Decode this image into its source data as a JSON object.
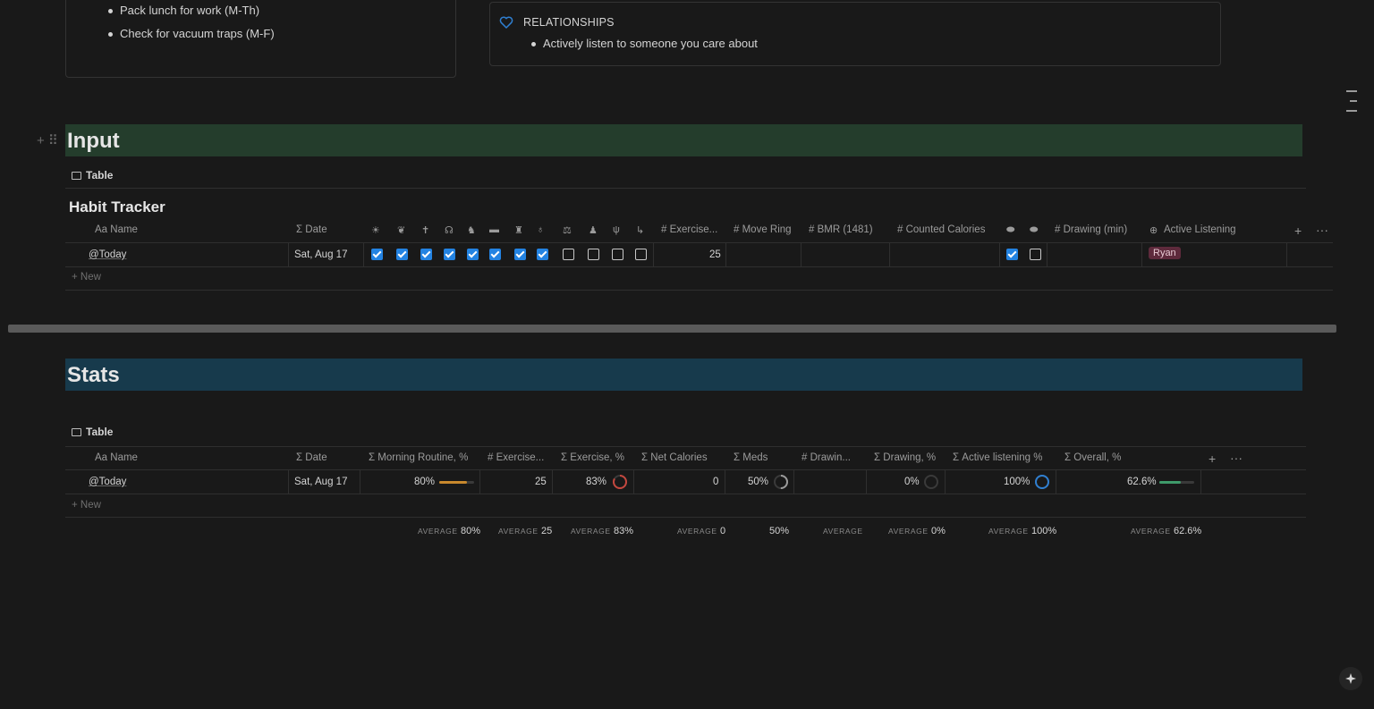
{
  "callout_left": {
    "items": [
      "Pack lunch for work (M-Th)",
      "Check for vacuum traps (M-F)"
    ]
  },
  "callout_right": {
    "title": "RELATIONSHIPS",
    "items": [
      "Actively listen to someone you care about"
    ]
  },
  "input_section": {
    "heading": "Input",
    "heading_color": "#243d2c",
    "view_tab": "Table",
    "db_title": "Habit Tracker",
    "columns": {
      "name": "Aa Name",
      "date": "Σ Date",
      "exercise": "# Exercise...",
      "move_ring": "# Move Ring",
      "bmr": "# BMR (1481)",
      "counted_calories": "# Counted Calories",
      "drawing": "# Drawing (min)",
      "active_listening": "Active Listening"
    },
    "row": {
      "name": "@Today",
      "date": "Sat, Aug 17",
      "habits": [
        true,
        true,
        true,
        true,
        true,
        true,
        true,
        true,
        false,
        false,
        false,
        false
      ],
      "exercise": "25",
      "pill_checks": [
        true,
        false
      ],
      "active_listening_tag": "Ryan"
    },
    "new_label": "New"
  },
  "stats_section": {
    "heading": "Stats",
    "heading_color": "#173a4c",
    "view_tab": "Table",
    "columns": {
      "name": "Aa Name",
      "date": "Σ Date",
      "morning": "Σ Morning Routine, %",
      "exercise": "# Exercise...",
      "exercise_pct": "Σ Exercise, %",
      "net_cal": "Σ Net Calories",
      "meds": "Σ Meds",
      "drawing": "# Drawin...",
      "drawing_pct": "Σ Drawing, %",
      "active_pct": "Σ Active listening %",
      "overall": "Σ Overall, %"
    },
    "row": {
      "name": "@Today",
      "date": "Sat, Aug 17",
      "morning": "80%",
      "morning_fraction": 0.8,
      "exercise": "25",
      "exercise_pct": "83%",
      "exercise_fraction": 0.83,
      "net_cal": "0",
      "meds": "50%",
      "meds_fraction": 0.5,
      "drawing_pct": "0%",
      "drawing_fraction": 0,
      "active_pct": "100%",
      "active_fraction": 1,
      "overall": "62.6%",
      "overall_fraction": 0.626
    },
    "new_label": "New",
    "footer": {
      "avg_label": "AVERAGE",
      "morning": "80%",
      "exercise": "25",
      "exercise_pct": "83%",
      "net_cal": "0",
      "meds": "50%",
      "drawing_pct": "0%",
      "active_pct": "100%",
      "overall": "62.6%"
    }
  },
  "colors": {
    "checkbox": "#2383e2",
    "morning_bar": "#c8892d",
    "exercise_ring": "#c4473e",
    "active_ring": "#2f7fd1",
    "overall_bar": "#3f9a6a"
  }
}
